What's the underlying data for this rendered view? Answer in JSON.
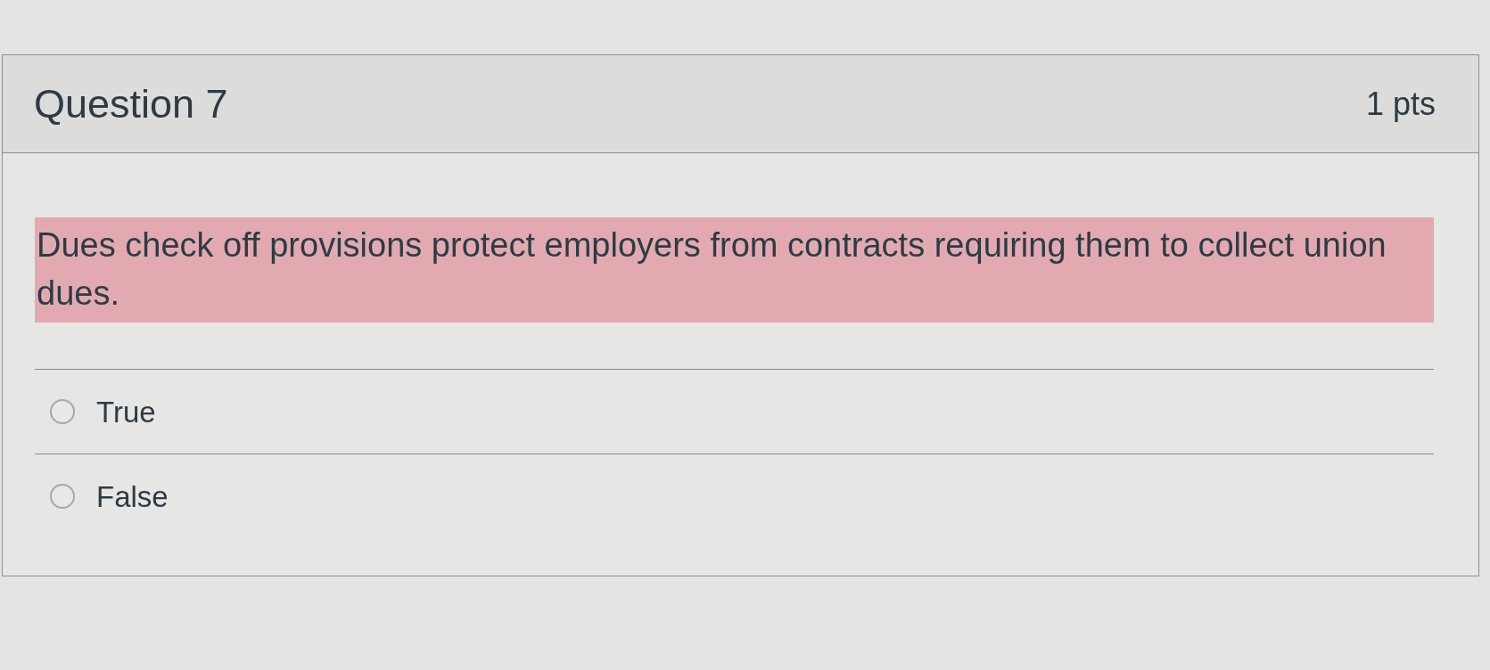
{
  "question": {
    "title": "Question 7",
    "points": "1 pts"
  },
  "prompt": {
    "text": "Dues check off provisions protect employers from contracts requiring them to collect union dues.",
    "highlighted": true
  },
  "answers": [
    {
      "label": "True",
      "selected": false
    },
    {
      "label": "False",
      "selected": false
    }
  ]
}
